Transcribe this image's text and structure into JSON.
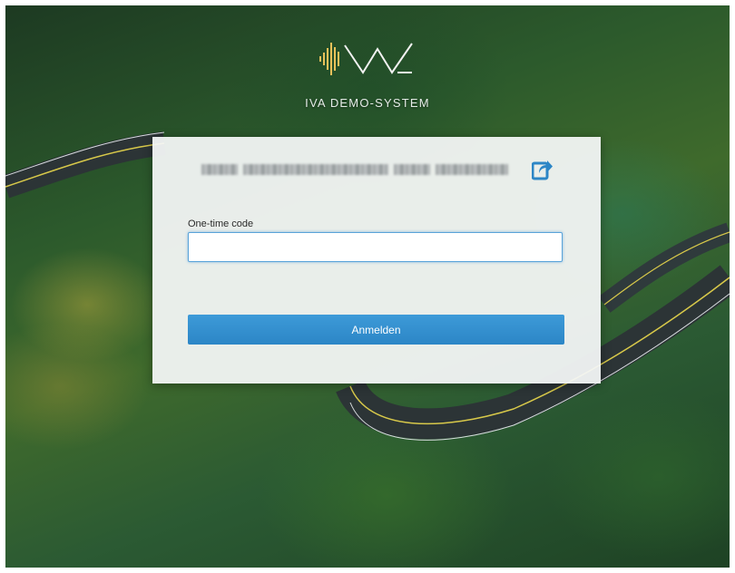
{
  "brand": {
    "name": "IVA DEMO-SYSTEM",
    "logo_icon": "iva-waveform-logo-icon"
  },
  "login_card": {
    "account_redacted": true,
    "switch_account_icon": "switch-account-icon",
    "code_label": "One-time code",
    "code_value": "",
    "submit_label": "Anmelden"
  },
  "colors": {
    "accent": "#2c86c6",
    "logo": "#e8c15a",
    "input_focus": "#5aa3d9"
  }
}
